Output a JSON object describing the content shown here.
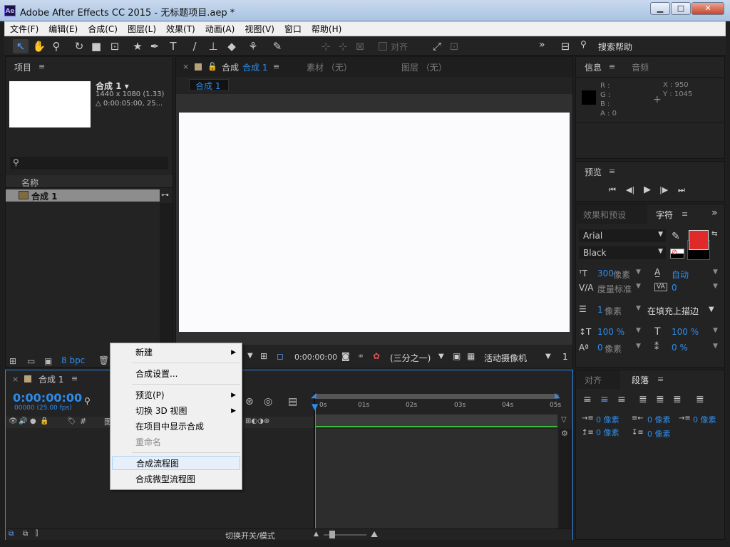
{
  "window": {
    "app_icon": "Ae",
    "title": "Adobe After Effects CC 2015 - 无标题项目.aep *",
    "min": "▁",
    "max": "□",
    "close": "✕"
  },
  "menubar": [
    "文件(F)",
    "编辑(E)",
    "合成(C)",
    "图层(L)",
    "效果(T)",
    "动画(A)",
    "视图(V)",
    "窗口",
    "帮助(H)"
  ],
  "toolbar": {
    "align_label": "对齐",
    "search_help": "搜索帮助",
    "overflow": "»"
  },
  "project": {
    "tab": "项目",
    "comp_name": "合成 1 ▾",
    "comp_dims": "1440 x 1080 (1.33)",
    "comp_dur": "△ 0:00:05:00, 25...",
    "search_placeholder": "",
    "col_name": "名称",
    "item_name": "合成 1",
    "bpc": "8 bpc"
  },
  "viewer": {
    "tabs": [
      "合成",
      "合成 1",
      "素材 （无）",
      "图层 （无）"
    ],
    "breadcrumb": "合成 1",
    "timecode": "0:00:00:00",
    "resolution": "(三分之一)",
    "camera": "活动摄像机",
    "views": "1"
  },
  "info": {
    "tab": "信息",
    "tab2": "音频",
    "r": "R :",
    "g": "G :",
    "b": "B :",
    "a": "A : 0",
    "x": "X : 950",
    "y": "Y : 1045"
  },
  "preview": {
    "tab": "预览"
  },
  "character": {
    "tab_effects": "效果和预设",
    "tab_char": "字符",
    "font": "Arial",
    "style": "Black",
    "size_val": "300",
    "size_unit": "像素",
    "leading_val": "自动",
    "kerning": "度量标准",
    "tracking": "0",
    "stroke_val": "1",
    "stroke_unit": "像素",
    "stroke_mode": "在填充上描边",
    "vscale": "100 %",
    "hscale": "100 %",
    "baseline": "0",
    "baseline_unit": "像素",
    "tsume": "0 %",
    "fill_color": "#e02a2a"
  },
  "paragraph": {
    "tab_align": "对齐",
    "tab_para": "段落",
    "indent_left": "0 像素",
    "indent_first": "0 像素",
    "indent_right": "0 像素",
    "space_before": "0 像素",
    "space_after": "0 像素"
  },
  "timeline": {
    "tab": "合成 1",
    "timecode": "0:00:00:00",
    "fps": "00000 (25.00 fps)",
    "ruler": [
      "0s",
      "01s",
      "02s",
      "03s",
      "04s",
      "05s"
    ],
    "hash": "#",
    "toggle_label": "切换开关/模式"
  },
  "context_menu": {
    "items": [
      "新建",
      "合成设置...",
      "预览(P)",
      "切换 3D 视图",
      "在项目中显示合成",
      "重命名",
      "合成流程图",
      "合成微型流程图"
    ]
  }
}
